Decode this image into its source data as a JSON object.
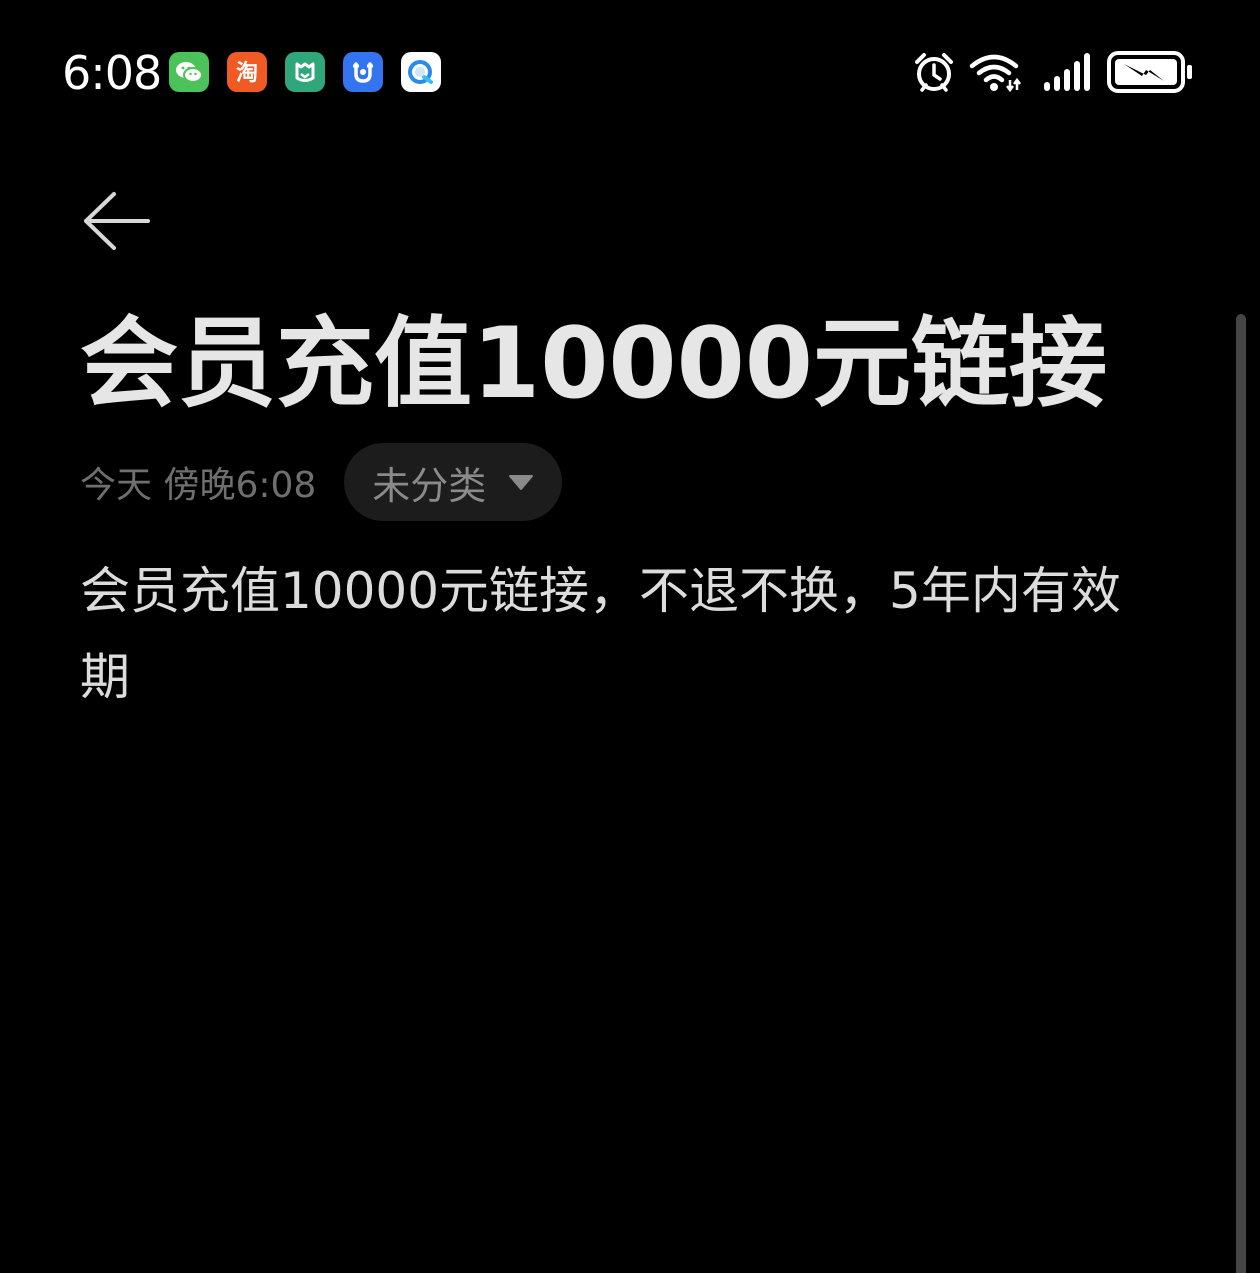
{
  "status_bar": {
    "time": "6:08",
    "notification_icons": [
      "wechat-icon",
      "taobao-icon",
      "mijia-icon",
      "app-shield-icon",
      "browser-icon"
    ],
    "system_icons": [
      "alarm-icon",
      "wifi-icon",
      "cellular-signal-icon",
      "battery-charging-icon"
    ]
  },
  "note": {
    "title": "会员充值10000元链接",
    "timestamp": "今天 傍晚6:08",
    "category": "未分类",
    "body": "会员充值10000元链接，不退不换，5年内有效期"
  },
  "colors": {
    "background": "#000000",
    "title": "#e6e6e6",
    "body": "#dcdcdc",
    "meta": "#6f6f6f",
    "chip_background": "#1c1c1c",
    "wechat": "#4cc25a",
    "taobao": "#f05a24",
    "mijia": "#2fa77a",
    "shield_app": "#3574f0"
  }
}
